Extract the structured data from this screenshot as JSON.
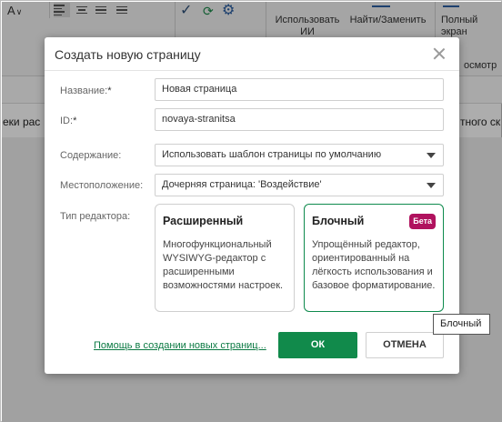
{
  "toolbar": {
    "font_glyph": "A",
    "font_suffix": "∨",
    "ai_label": "Использовать ИИ",
    "find_replace_label": "Найти/Заменить",
    "fullscreen_label": "Полный экран",
    "preview_label": "осмотр"
  },
  "background": {
    "left_text": "еки рас",
    "right_text": "тного ск"
  },
  "dialog": {
    "title": "Создать новую страницу",
    "fields": {
      "name_label": "Название:",
      "name_required": "*",
      "name_value": "Новая страница",
      "id_label": "ID:",
      "id_required": "*",
      "id_value": "novaya-stranitsa",
      "content_label": "Содержание:",
      "content_value": "Использовать шаблон страницы по умолчанию",
      "location_label": "Местоположение:",
      "location_value": "Дочерняя страница: 'Воздействие'",
      "editor_type_label": "Тип редактора:"
    },
    "editors": [
      {
        "title": "Расширенный",
        "description": "Многофункциональный WYSIWYG-редактор с расширенными возможностями настроек."
      },
      {
        "title": "Блочный",
        "badge": "Бета",
        "description": "Упрощённый редактор, ориентированный на лёгкость использования и базовое форматирование."
      }
    ],
    "help_link": "Помощь в создании новых страниц...",
    "ok_label": "ОК",
    "cancel_label": "ОТМЕНА"
  },
  "tooltip": "Блочный",
  "colors": {
    "accent_green": "#118a4b",
    "beta_badge": "#b0125e",
    "link_green": "#0b7a43"
  }
}
